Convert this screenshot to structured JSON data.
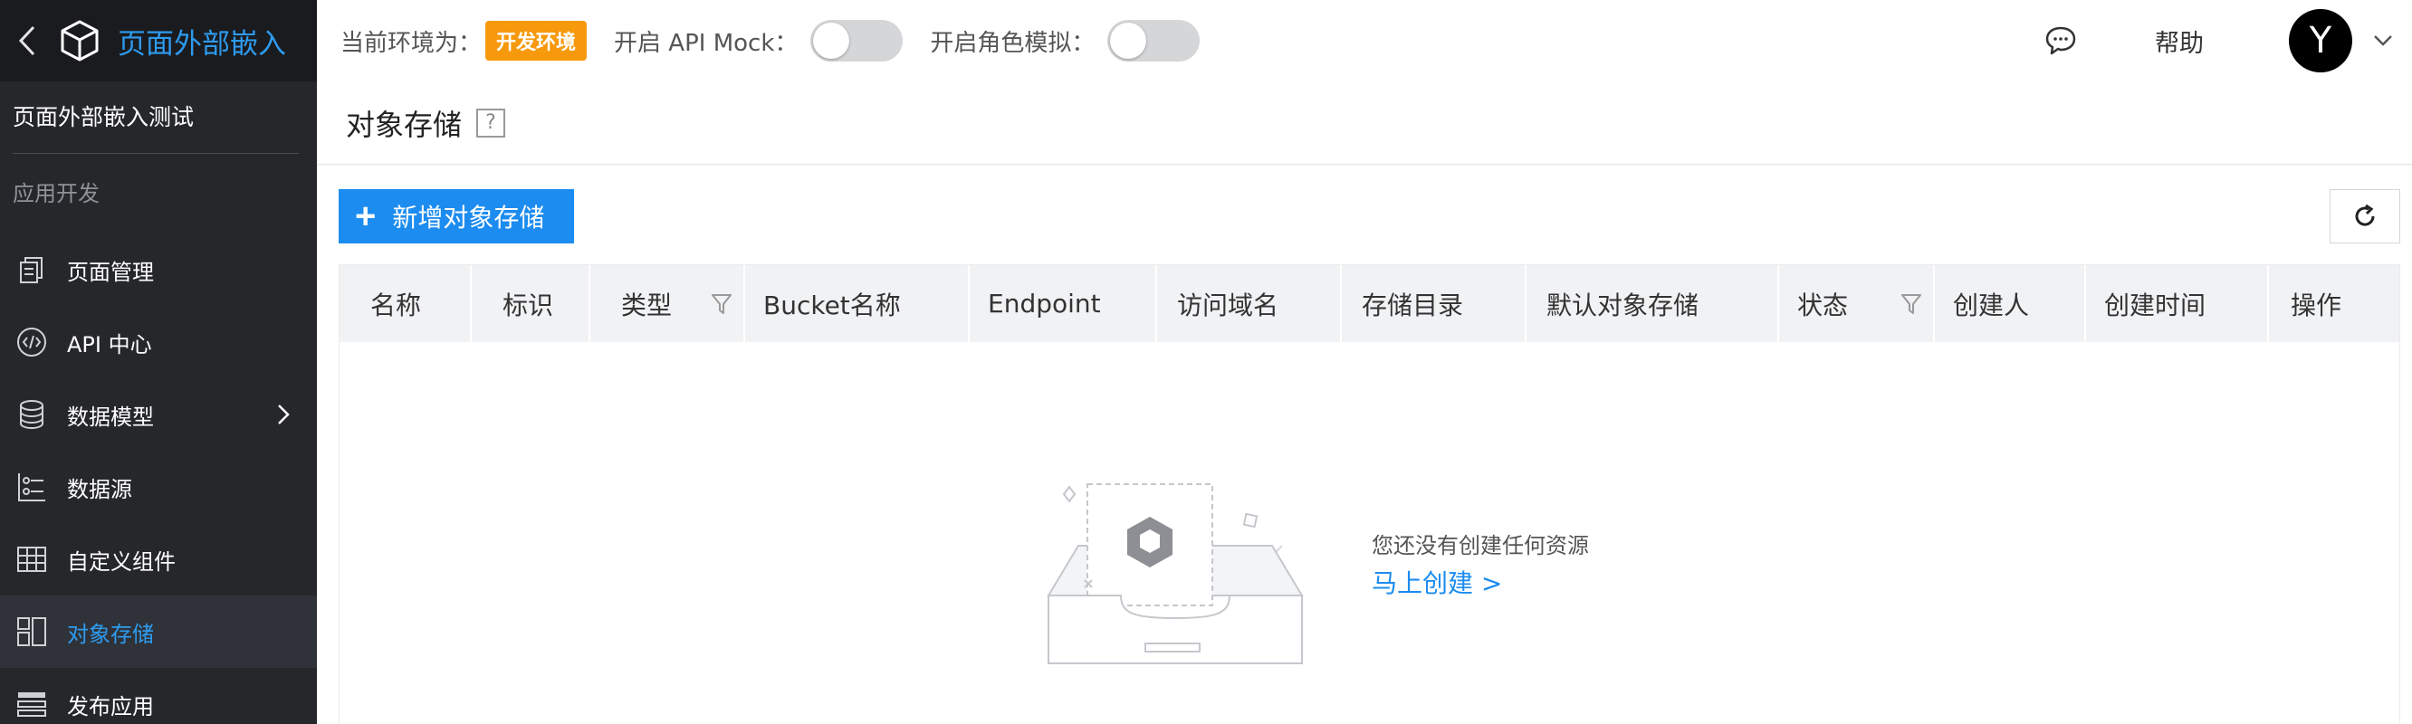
{
  "app": {
    "name": "页面外部嵌入"
  },
  "sidebar": {
    "project": "页面外部嵌入测试",
    "group_label": "应用开发",
    "items": [
      {
        "label": "页面管理",
        "icon": "page-icon"
      },
      {
        "label": "API 中心",
        "icon": "api-icon"
      },
      {
        "label": "数据模型",
        "icon": "database-icon"
      },
      {
        "label": "数据源",
        "icon": "datasource-icon"
      },
      {
        "label": "自定义组件",
        "icon": "component-icon"
      },
      {
        "label": "对象存储",
        "icon": "storage-icon",
        "active": true
      },
      {
        "label": "发布应用",
        "icon": "publish-icon"
      }
    ]
  },
  "topbar": {
    "env_label": "当前环境为：",
    "env_badge": "开发环境",
    "api_mock_label": "开启 API Mock：",
    "role_sim_label": "开启角色模拟：",
    "help": "帮助",
    "avatar_letter": "Y"
  },
  "page": {
    "title": "对象存储",
    "help_mark": "?",
    "add_button": "新增对象存储",
    "add_plus": "+"
  },
  "table": {
    "columns": [
      "名称",
      "标识",
      "类型",
      "Bucket名称",
      "Endpoint",
      "访问域名",
      "存储目录",
      "默认对象存储",
      "状态",
      "创建人",
      "创建时间",
      "操作"
    ]
  },
  "empty": {
    "message": "您还没有创建任何资源",
    "action": "马上创建 >"
  },
  "colors": {
    "accent": "#1c8cf0",
    "badge": "#f7990c",
    "sidebar_bg": "#25272b"
  }
}
